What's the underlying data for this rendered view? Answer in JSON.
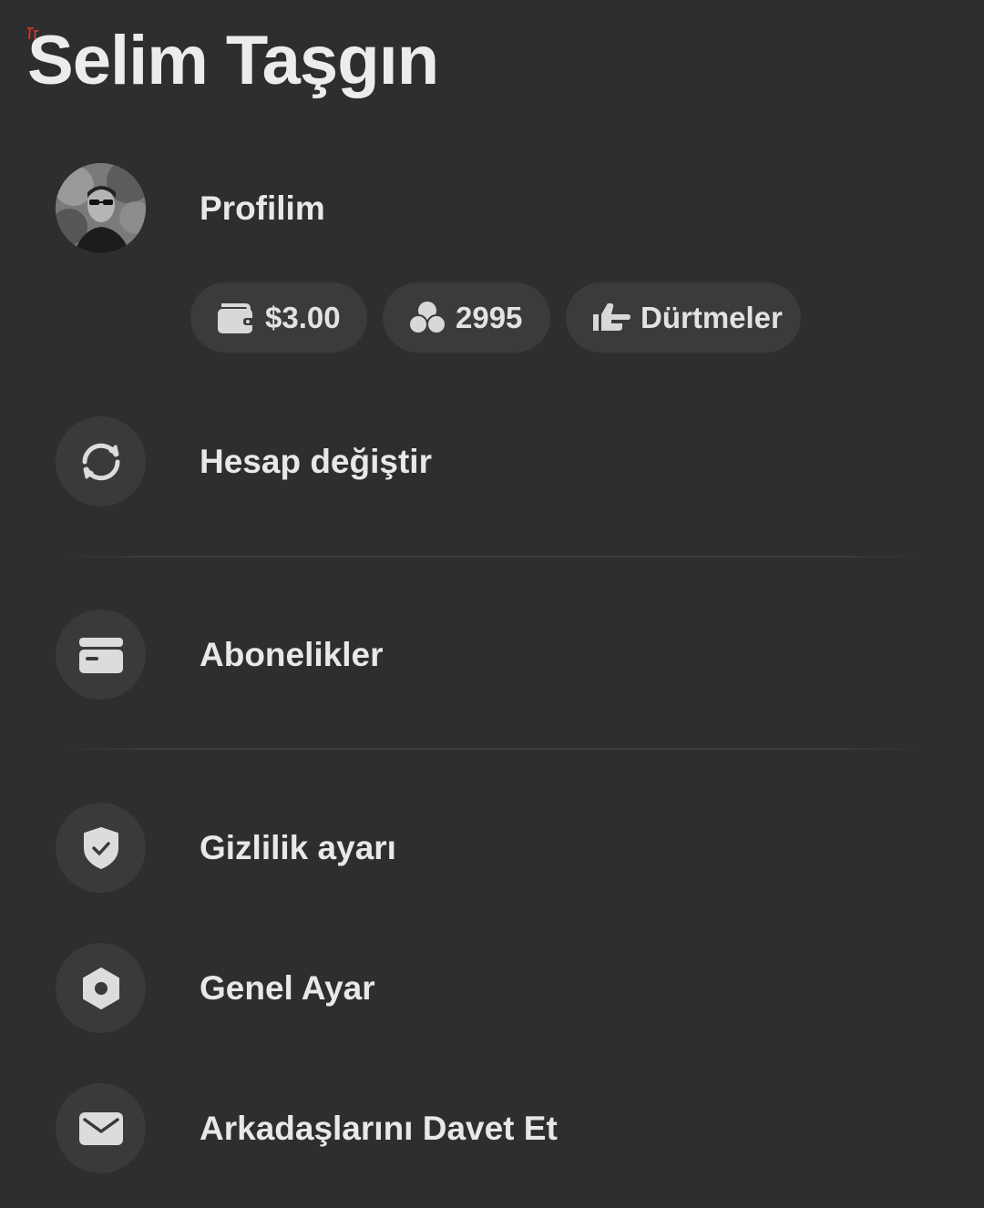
{
  "header": {
    "title": "Selim Taşgın"
  },
  "profile": {
    "label": "Profilim",
    "avatar_icon": "avatar-photo"
  },
  "chips": [
    {
      "icon": "wallet-icon",
      "label": "$3.00"
    },
    {
      "icon": "coins-icon",
      "label": "2995"
    },
    {
      "icon": "poke-hand-icon",
      "label": "Dürtmeler"
    }
  ],
  "menu": {
    "switch_account": {
      "icon": "sync-icon",
      "label": "Hesap değiştir"
    },
    "subscriptions": {
      "icon": "card-icon",
      "label": "Abonelikler"
    },
    "privacy": {
      "icon": "shield-check-icon",
      "label": "Gizlilik ayarı"
    },
    "general": {
      "icon": "hexagon-settings-icon",
      "label": "Genel Ayar"
    },
    "invite": {
      "icon": "envelope-icon",
      "label": "Arkadaşlarını Davet Et"
    }
  },
  "colors": {
    "background": "#2e2e2f",
    "icon_circle": "#3a3a3b",
    "chip": "#3b3b3c",
    "text": "#e8e8e8",
    "accent_mark": "#c0392b"
  }
}
